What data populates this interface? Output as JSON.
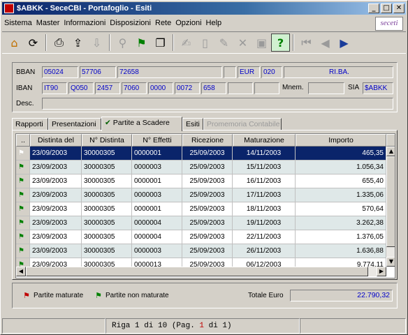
{
  "window": {
    "title": "$ABKK - SeceCBI - Portafoglio - Esiti"
  },
  "menu": [
    "Sistema",
    "Master",
    "Informazioni",
    "Disposizioni",
    "Rete",
    "Opzioni",
    "Help"
  ],
  "logo": "seceti",
  "toolbar": [
    {
      "icon": "home-icon",
      "glyph": "⌂",
      "enabled": true
    },
    {
      "icon": "refresh-icon",
      "glyph": "⟳",
      "enabled": true
    },
    {
      "icon": "print-icon",
      "glyph": "⎙",
      "enabled": true
    },
    {
      "icon": "upload-icon",
      "glyph": "⇪",
      "enabled": true
    },
    {
      "icon": "download-icon",
      "glyph": "⇩",
      "enabled": false
    },
    {
      "icon": "search-icon",
      "glyph": "⚲",
      "enabled": false
    },
    {
      "icon": "flag-icon",
      "glyph": "⚑",
      "enabled": true
    },
    {
      "icon": "copy-icon",
      "glyph": "❐",
      "enabled": true
    },
    {
      "icon": "send-icon",
      "glyph": "✍",
      "enabled": false
    },
    {
      "icon": "new-doc-icon",
      "glyph": "▯",
      "enabled": false
    },
    {
      "icon": "edit-icon",
      "glyph": "✎",
      "enabled": false
    },
    {
      "icon": "delete-icon",
      "glyph": "✕",
      "enabled": false
    },
    {
      "icon": "save-icon",
      "glyph": "▣",
      "enabled": false
    },
    {
      "icon": "help-icon",
      "glyph": "?",
      "enabled": true
    },
    {
      "icon": "first-record-icon",
      "glyph": "⏮",
      "enabled": false
    },
    {
      "icon": "prev-record-icon",
      "glyph": "◀",
      "enabled": false
    },
    {
      "icon": "next-record-icon",
      "glyph": "▶",
      "enabled": true
    }
  ],
  "info": {
    "bban_label": "BBAN",
    "bban": [
      "05024",
      "57706",
      "72658",
      "",
      "EUR",
      "020",
      "RI.BA."
    ],
    "iban_label": "IBAN",
    "iban": [
      "IT90",
      "Q050",
      "2457",
      "7060",
      "0000",
      "0072",
      "658",
      "",
      ""
    ],
    "mnem_label": "Mnem.",
    "mnem": "",
    "sia_label": "SIA",
    "sia": "$ABKK",
    "desc_label": "Desc.",
    "desc": ""
  },
  "tabs": [
    {
      "label": "Rapporti",
      "state": "normal"
    },
    {
      "label": "Presentazioni",
      "state": "normal"
    },
    {
      "label": "Partite a Scadere",
      "state": "active"
    },
    {
      "label": "Esiti",
      "state": "normal"
    },
    {
      "label": "Promemoria Contabile",
      "state": "disabled"
    }
  ],
  "table": {
    "columns": [
      "..",
      "Distinta del",
      "N° Distinta",
      "N° Effetti",
      "Ricezione",
      "Maturazione",
      "Importo"
    ],
    "rows": [
      [
        "23/09/2003",
        "30000305",
        "0000001",
        "25/09/2003",
        "14/11/2003",
        "465,35"
      ],
      [
        "23/09/2003",
        "30000305",
        "0000003",
        "25/09/2003",
        "15/11/2003",
        "1.056,34"
      ],
      [
        "23/09/2003",
        "30000305",
        "0000001",
        "25/09/2003",
        "16/11/2003",
        "655,40"
      ],
      [
        "23/09/2003",
        "30000305",
        "0000003",
        "25/09/2003",
        "17/11/2003",
        "1.335,06"
      ],
      [
        "23/09/2003",
        "30000305",
        "0000001",
        "25/09/2003",
        "18/11/2003",
        "570,64"
      ],
      [
        "23/09/2003",
        "30000305",
        "0000004",
        "25/09/2003",
        "19/11/2003",
        "3.262,38"
      ],
      [
        "23/09/2003",
        "30000305",
        "0000004",
        "25/09/2003",
        "22/11/2003",
        "1.376,05"
      ],
      [
        "23/09/2003",
        "30000305",
        "0000003",
        "25/09/2003",
        "26/11/2003",
        "1.636,88"
      ],
      [
        "23/09/2003",
        "30000305",
        "0000013",
        "25/09/2003",
        "06/12/2003",
        "9.774,11"
      ]
    ],
    "selected_row": 0
  },
  "legend": {
    "matured": "Partite maturate",
    "not_matured": "Partite non maturate",
    "total_label": "Totale Euro",
    "total_value": "22.790,32"
  },
  "status": {
    "text_before": "Riga 1 di 10  (Pag. ",
    "page": "1",
    "text_after": " di 1)"
  },
  "colors": {
    "matured_flag": "#c00000",
    "not_matured_flag": "#008000",
    "value_text": "#0000c8",
    "selection": "#0a246a"
  }
}
